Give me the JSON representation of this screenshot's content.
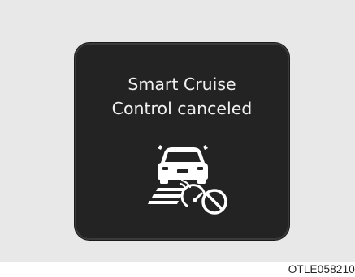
{
  "display": {
    "message_line1": "Smart Cruise",
    "message_line2": "Control canceled",
    "icon": "smart-cruise-control-canceled-icon"
  },
  "caption": "OTLE058210",
  "colors": {
    "panel_background": "#232323",
    "text": "#f2f2f2",
    "surround": "#e8e8e8"
  }
}
